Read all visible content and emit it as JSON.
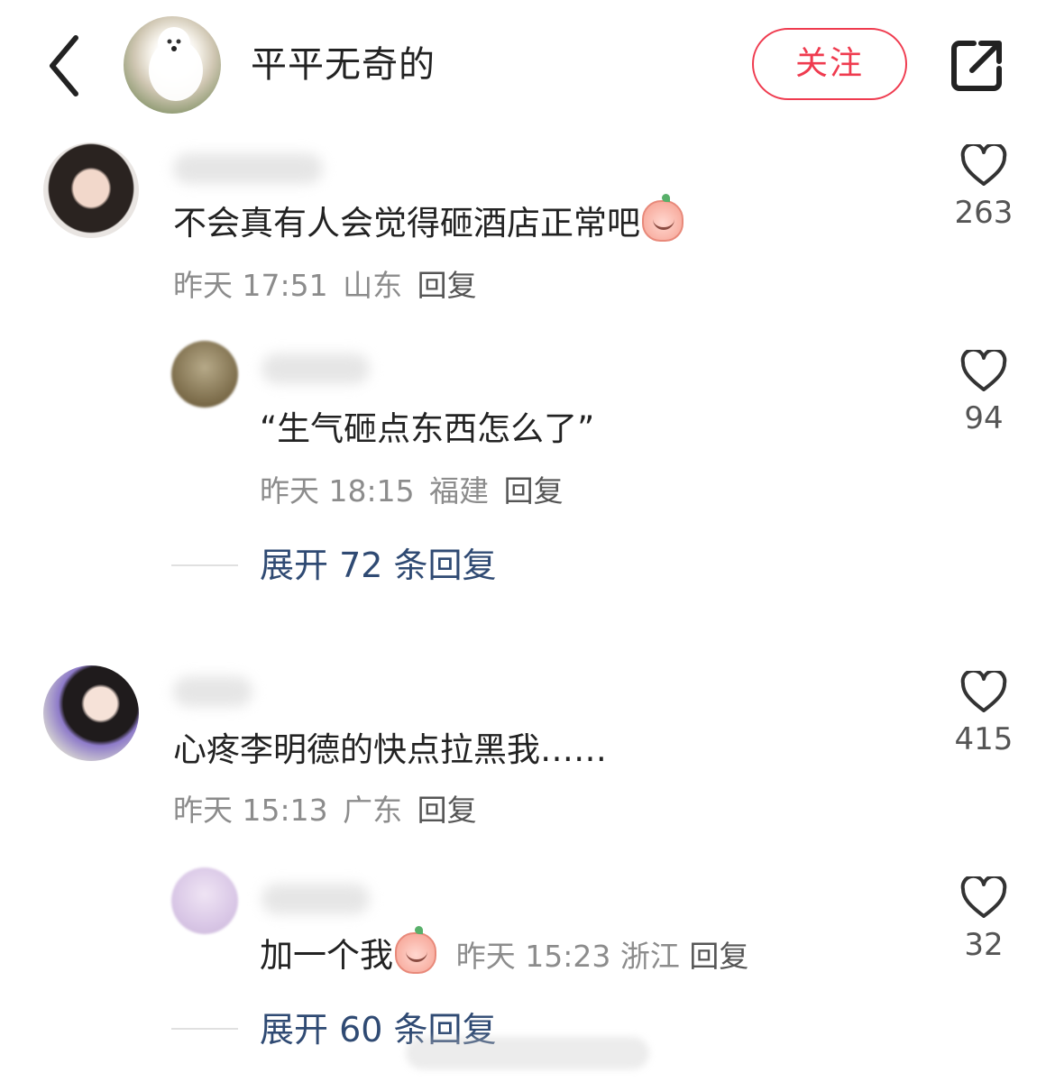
{
  "header": {
    "author_name": "平平无奇的",
    "follow_label": "关注"
  },
  "comments": [
    {
      "text": "不会真有人会觉得砸酒店正常吧",
      "time": "昨天 17:51",
      "location": "山东",
      "reply_label": "回复",
      "likes": "263",
      "emoji": "smiling-peach-emoji",
      "replies": [
        {
          "text": "“生气砸点东西怎么了”",
          "time": "昨天 18:15",
          "location": "福建",
          "reply_label": "回复",
          "likes": "94"
        }
      ],
      "expand_label": "展开 72 条回复"
    },
    {
      "text": "心疼李明德的快点拉黑我……",
      "time": "昨天 15:13",
      "location": "广东",
      "reply_label": "回复",
      "likes": "415",
      "replies": [
        {
          "text": "加一个我",
          "emoji": "kissing-peach-emoji",
          "time": "昨天 15:23",
          "location": "浙江",
          "reply_label": "回复",
          "likes": "32"
        }
      ],
      "expand_label": "展开 60 条回复"
    }
  ],
  "colors": {
    "accent_red": "#ef3b4f",
    "link_blue": "#2f4a73",
    "meta_gray": "#8c8c8c"
  }
}
